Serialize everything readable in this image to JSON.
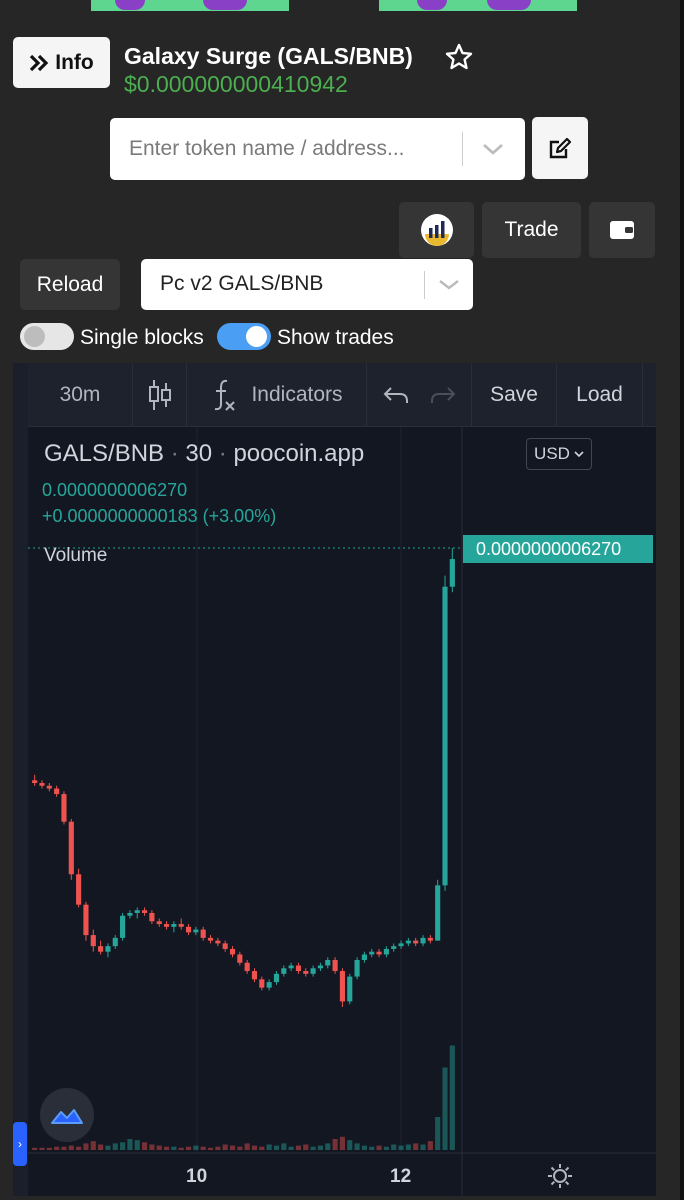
{
  "header": {
    "info_label": "Info",
    "token_name": "Galaxy Surge (GALS/BNB)",
    "price": "$0.000000000410942"
  },
  "search": {
    "placeholder": "Enter token name / address..."
  },
  "actions": {
    "trade_label": "Trade",
    "reload_label": "Reload",
    "pair_selected": "Pc v2 GALS/BNB"
  },
  "toggles": {
    "single_blocks_label": "Single blocks",
    "single_blocks_on": false,
    "show_trades_label": "Show trades",
    "show_trades_on": true
  },
  "toolbar": {
    "interval": "30m",
    "indicators_label": "Indicators",
    "save_label": "Save",
    "load_label": "Load"
  },
  "chart_legend": {
    "symbol": "GALS/BNB",
    "interval": "30",
    "source": "poocoin.app",
    "last_value": "0.0000000006270",
    "change": "+0.0000000000183 (+3.00%)",
    "volume_label": "Volume",
    "currency": "USD",
    "last_price_tag": "0.0000000006270"
  },
  "colors": {
    "up": "#26a69a",
    "down": "#ef5350",
    "price_green": "#4caf50",
    "toggle_on": "#4a9ff5"
  },
  "chart_data": {
    "type": "candlestick",
    "series": [
      {
        "name": "GALS/BNB",
        "values_note": ""
      }
    ],
    "x_ticks": [
      "10",
      "12"
    ],
    "last_price": 6.27e-10,
    "candles_relative": [
      [
        0.58,
        0.59,
        0.57,
        0.575
      ],
      [
        0.575,
        0.58,
        0.565,
        0.57
      ],
      [
        0.57,
        0.575,
        0.56,
        0.565
      ],
      [
        0.565,
        0.57,
        0.55,
        0.555
      ],
      [
        0.555,
        0.56,
        0.5,
        0.505
      ],
      [
        0.505,
        0.51,
        0.4,
        0.41
      ],
      [
        0.41,
        0.42,
        0.35,
        0.355
      ],
      [
        0.355,
        0.36,
        0.29,
        0.3
      ],
      [
        0.3,
        0.31,
        0.27,
        0.28
      ],
      [
        0.28,
        0.29,
        0.265,
        0.27
      ],
      [
        0.27,
        0.285,
        0.26,
        0.28
      ],
      [
        0.28,
        0.3,
        0.275,
        0.295
      ],
      [
        0.295,
        0.34,
        0.29,
        0.335
      ],
      [
        0.335,
        0.345,
        0.33,
        0.34
      ],
      [
        0.34,
        0.35,
        0.33,
        0.345
      ],
      [
        0.345,
        0.35,
        0.335,
        0.34
      ],
      [
        0.34,
        0.345,
        0.32,
        0.325
      ],
      [
        0.325,
        0.33,
        0.315,
        0.32
      ],
      [
        0.32,
        0.325,
        0.31,
        0.315
      ],
      [
        0.315,
        0.325,
        0.305,
        0.32
      ],
      [
        0.32,
        0.33,
        0.31,
        0.315
      ],
      [
        0.315,
        0.32,
        0.3,
        0.305
      ],
      [
        0.305,
        0.315,
        0.3,
        0.31
      ],
      [
        0.31,
        0.315,
        0.29,
        0.295
      ],
      [
        0.295,
        0.3,
        0.285,
        0.29
      ],
      [
        0.29,
        0.295,
        0.28,
        0.285
      ],
      [
        0.285,
        0.29,
        0.27,
        0.275
      ],
      [
        0.275,
        0.28,
        0.26,
        0.265
      ],
      [
        0.265,
        0.27,
        0.245,
        0.25
      ],
      [
        0.25,
        0.255,
        0.23,
        0.235
      ],
      [
        0.235,
        0.24,
        0.215,
        0.22
      ],
      [
        0.22,
        0.225,
        0.2,
        0.205
      ],
      [
        0.205,
        0.22,
        0.2,
        0.215
      ],
      [
        0.215,
        0.235,
        0.21,
        0.23
      ],
      [
        0.23,
        0.245,
        0.225,
        0.24
      ],
      [
        0.24,
        0.25,
        0.235,
        0.245
      ],
      [
        0.245,
        0.25,
        0.23,
        0.235
      ],
      [
        0.235,
        0.24,
        0.225,
        0.23
      ],
      [
        0.23,
        0.245,
        0.225,
        0.24
      ],
      [
        0.24,
        0.25,
        0.235,
        0.245
      ],
      [
        0.245,
        0.26,
        0.24,
        0.255
      ],
      [
        0.255,
        0.26,
        0.23,
        0.235
      ],
      [
        0.235,
        0.24,
        0.17,
        0.18
      ],
      [
        0.18,
        0.23,
        0.175,
        0.225
      ],
      [
        0.225,
        0.26,
        0.22,
        0.255
      ],
      [
        0.255,
        0.27,
        0.25,
        0.265
      ],
      [
        0.265,
        0.275,
        0.26,
        0.27
      ],
      [
        0.27,
        0.275,
        0.26,
        0.265
      ],
      [
        0.265,
        0.28,
        0.26,
        0.275
      ],
      [
        0.275,
        0.285,
        0.27,
        0.28
      ],
      [
        0.28,
        0.29,
        0.275,
        0.285
      ],
      [
        0.285,
        0.295,
        0.28,
        0.29
      ],
      [
        0.29,
        0.295,
        0.28,
        0.285
      ],
      [
        0.285,
        0.3,
        0.28,
        0.295
      ],
      [
        0.295,
        0.3,
        0.285,
        0.29
      ],
      [
        0.29,
        0.4,
        0.29,
        0.39
      ],
      [
        0.39,
        0.95,
        0.38,
        0.93
      ],
      [
        0.93,
        1.0,
        0.92,
        0.98
      ]
    ],
    "volumes_relative": [
      0.02,
      0.02,
      0.02,
      0.03,
      0.03,
      0.04,
      0.03,
      0.06,
      0.08,
      0.05,
      0.04,
      0.06,
      0.07,
      0.1,
      0.09,
      0.07,
      0.05,
      0.04,
      0.03,
      0.03,
      0.02,
      0.03,
      0.04,
      0.03,
      0.02,
      0.03,
      0.05,
      0.04,
      0.03,
      0.06,
      0.04,
      0.03,
      0.05,
      0.04,
      0.06,
      0.03,
      0.04,
      0.05,
      0.03,
      0.04,
      0.06,
      0.1,
      0.12,
      0.09,
      0.06,
      0.04,
      0.03,
      0.04,
      0.03,
      0.05,
      0.04,
      0.05,
      0.06,
      0.05,
      0.08,
      0.3,
      0.75,
      0.95
    ]
  }
}
